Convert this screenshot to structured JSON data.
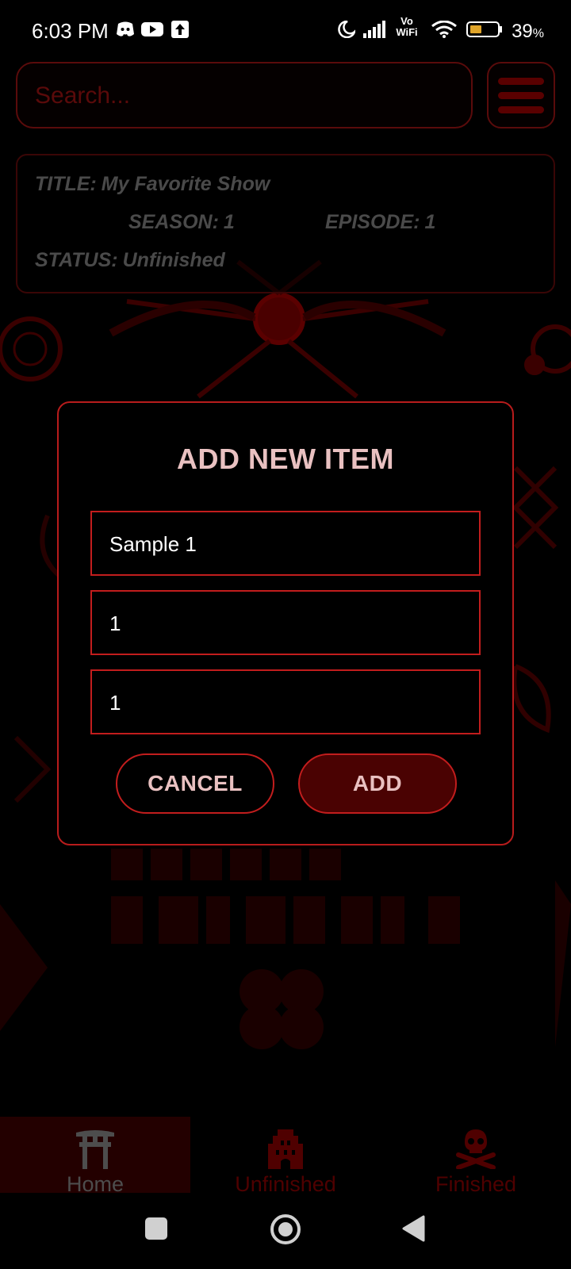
{
  "status_bar": {
    "time": "6:03 PM",
    "battery_percent": "39",
    "battery_unit": "%",
    "icons": [
      "discord-icon",
      "youtube-icon",
      "upload-icon",
      "moon-icon",
      "signal-icon",
      "vowifi-icon",
      "wifi-icon",
      "battery-icon"
    ],
    "vowifi_top": "Vo",
    "vowifi_bottom": "WiFi"
  },
  "search": {
    "placeholder": "Search..."
  },
  "item_card": {
    "title_label": "TITLE:",
    "title_value": "My Favorite Show",
    "season_label": "SEASON:",
    "season_value": "1",
    "episode_label": "EPISODE:",
    "episode_value": "1",
    "status_label": "STATUS:",
    "status_value": "Unfinished"
  },
  "dialog": {
    "title": "ADD NEW ITEM",
    "fields": [
      {
        "value": "Sample 1"
      },
      {
        "value": "1"
      },
      {
        "value": "1"
      }
    ],
    "cancel_label": "CANCEL",
    "add_label": "ADD"
  },
  "bottom_nav": {
    "items": [
      {
        "label": "Home",
        "icon": "torii-gate-icon",
        "active": true
      },
      {
        "label": "Unfinished",
        "icon": "castle-icon",
        "active": false
      },
      {
        "label": "Finished",
        "icon": "skull-crossbones-icon",
        "active": false
      }
    ]
  },
  "system_nav": {
    "icons": [
      "recents-square-icon",
      "home-circle-icon",
      "back-triangle-icon"
    ]
  },
  "colors": {
    "accent_red": "#c21d1d",
    "dark_red": "#4a0202",
    "dialog_text": "#e9c1c1",
    "card_text": "#4a4a4a"
  }
}
